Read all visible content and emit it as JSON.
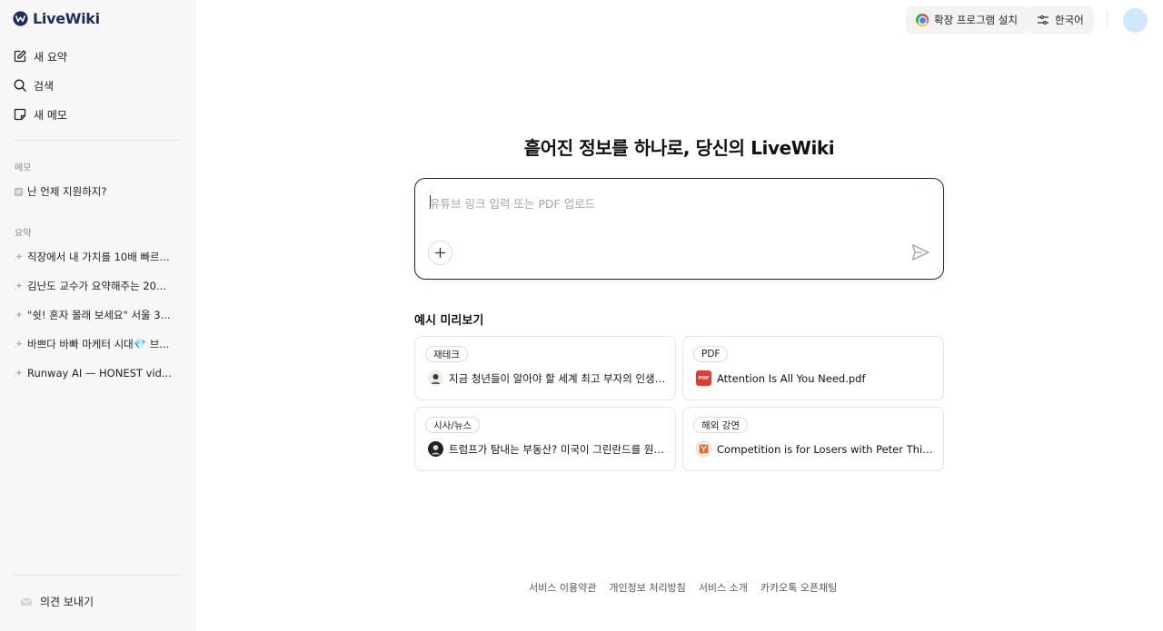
{
  "brand": {
    "name": "LiveWiki",
    "color": "#1f2b5c"
  },
  "sidebar": {
    "nav": [
      {
        "label": "새 요약",
        "icon": "edit-icon"
      },
      {
        "label": "검색",
        "icon": "search-icon"
      },
      {
        "label": "새 메모",
        "icon": "note-icon"
      }
    ],
    "memo_label": "메모",
    "memos": [
      {
        "label": "난 언제 지원하지?",
        "icon": "memo-icon"
      }
    ],
    "summary_label": "요약",
    "summaries": [
      {
        "label": "직장에서 내 가치를 10배 빠르...",
        "icon": "sparkle-icon"
      },
      {
        "label": "김난도 교수가 요약해주는 20...",
        "icon": "sparkle-icon"
      },
      {
        "label": "\"쉿! 혼자 몰래 보세요\" 서울 3...",
        "icon": "sparkle-icon"
      },
      {
        "label": "바쁘다 바빠 마케터 시대💎 브...",
        "icon": "sparkle-icon"
      },
      {
        "label": "Runway AI — HONEST vid...",
        "icon": "sparkle-icon"
      }
    ],
    "feedback_label": "의견 보내기"
  },
  "header": {
    "extension_label": "확장 프로그램 설치",
    "language_label": "한국어"
  },
  "main": {
    "title": "흩어진 정보를 하나로, 당신의 LiveWiki",
    "input_placeholder": "유튜브 링크 입력 또는 PDF 업로드",
    "examples_title": "예시 미리보기",
    "examples": [
      {
        "tag": "재테크",
        "title": "지금 청년들이 알아야 할 세계 최고 부자의 인생 조언",
        "icon": "person-thumb-icon"
      },
      {
        "tag": "PDF",
        "title": "Attention Is All You Need.pdf",
        "icon": "pdf-icon"
      },
      {
        "tag": "시사/뉴스",
        "title": "트럼프가 탐내는 부동산? 미국이 그린란드를 원하...",
        "icon": "channel-thumb-icon"
      },
      {
        "tag": "해외 강연",
        "title": "Competition is for Losers with Peter Thiel (H...",
        "icon": "ycombinator-icon"
      }
    ]
  },
  "footer": {
    "links": [
      "서비스 이용약관",
      "개인정보 처리방침",
      "서비스 소개",
      "카카오톡 오픈채팅"
    ]
  }
}
